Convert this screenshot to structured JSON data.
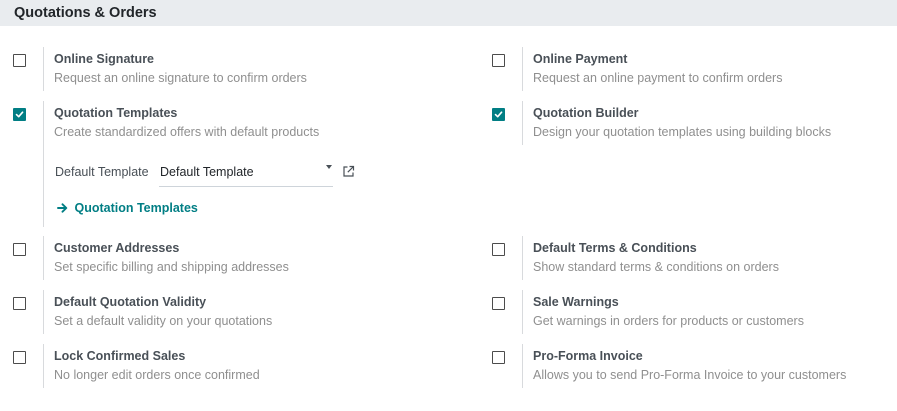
{
  "section": {
    "title": "Quotations & Orders"
  },
  "colors": {
    "accent": "#017e84",
    "header_bg": "#e9ecef"
  },
  "settings": {
    "online_signature": {
      "title": "Online Signature",
      "desc": "Request an online signature to confirm orders",
      "checked": false
    },
    "online_payment": {
      "title": "Online Payment",
      "desc": "Request an online payment to confirm orders",
      "checked": false
    },
    "quotation_templates": {
      "title": "Quotation Templates",
      "desc": "Create standardized offers with default products",
      "checked": true
    },
    "quotation_builder": {
      "title": "Quotation Builder",
      "desc": "Design your quotation templates using building blocks",
      "checked": true
    },
    "customer_addresses": {
      "title": "Customer Addresses",
      "desc": "Set specific billing and shipping addresses",
      "checked": false
    },
    "default_terms": {
      "title": "Default Terms & Conditions",
      "desc": "Show standard terms & conditions on orders",
      "checked": false
    },
    "default_validity": {
      "title": "Default Quotation Validity",
      "desc": "Set a default validity on your quotations",
      "checked": false
    },
    "sale_warnings": {
      "title": "Sale Warnings",
      "desc": "Get warnings in orders for products or customers",
      "checked": false
    },
    "lock_confirmed": {
      "title": "Lock Confirmed Sales",
      "desc": "No longer edit orders once confirmed",
      "checked": false
    },
    "proforma_invoice": {
      "title": "Pro-Forma Invoice",
      "desc": "Allows you to send Pro-Forma Invoice to your customers",
      "checked": false
    }
  },
  "default_template": {
    "label": "Default Template",
    "value": "Default Template",
    "link_label": "Quotation Templates",
    "link_icon": "arrow-right-icon",
    "external_icon": "external-link-icon"
  }
}
